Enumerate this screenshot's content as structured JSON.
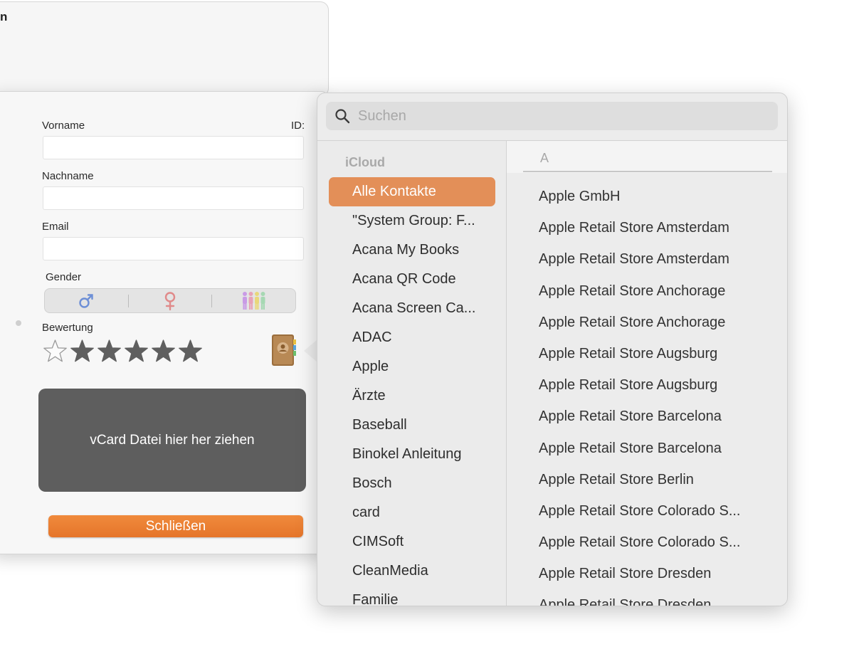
{
  "window": {
    "title_fragment": "n"
  },
  "form": {
    "vorname_label": "Vorname",
    "id_label": "ID:",
    "nachname_label": "Nachname",
    "email_label": "Email",
    "gender_label": "Gender",
    "rating_label": "Bewertung",
    "rating": {
      "filled": 5,
      "total": 6
    },
    "vorname_value": "",
    "nachname_value": "",
    "email_value": "",
    "dropzone_text": "vCard Datei hier her ziehen",
    "close_button": "Schließen"
  },
  "gender_icons": [
    "male-symbol-icon",
    "female-symbol-icon",
    "group-people-icon"
  ],
  "colors": {
    "accent": "#e5752a",
    "selected_group": "#e38f58",
    "dropzone": "#5e5e5e"
  },
  "popover": {
    "search_placeholder": "Suchen",
    "group_header": "iCloud",
    "groups": [
      "Alle Kontakte",
      "\"System Group: F...",
      "Acana My Books",
      "Acana QR Code",
      "Acana Screen Ca...",
      "ADAC",
      "Apple",
      "Ärzte",
      "Baseball",
      "Binokel Anleitung",
      "Bosch",
      "card",
      "CIMSoft",
      "CleanMedia",
      "Familie"
    ],
    "selected_group": "Alle Kontakte",
    "section_letter": "A",
    "contacts": [
      "Apple GmbH",
      "Apple Retail Store Amsterdam",
      "Apple Retail Store Amsterdam",
      "Apple Retail Store Anchorage",
      "Apple Retail Store Anchorage",
      "Apple Retail Store Augsburg",
      "Apple Retail Store Augsburg",
      "Apple Retail Store Barcelona",
      "Apple Retail Store Barcelona",
      "Apple Retail Store Berlin",
      "Apple Retail Store Colorado S...",
      "Apple Retail Store Colorado S...",
      "Apple Retail Store Dresden",
      "Apple Retail Store Dresden"
    ]
  }
}
